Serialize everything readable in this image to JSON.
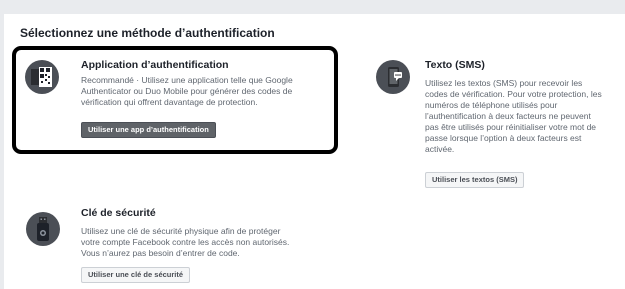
{
  "page": {
    "title": "Sélectionnez une méthode d’authentification"
  },
  "auth_app": {
    "icon": "qr-code-phone-icon",
    "title": "Application d’authentification",
    "desc_lines": [
      "Recommandé · Utilisez une application telle que Google",
      "Authenticator ou Duo Mobile pour générer des codes de",
      "vérification qui offrent davantage de protection."
    ],
    "button_label": "Utiliser une app d’authentification"
  },
  "sms": {
    "icon": "sms-phone-icon",
    "title": "Texto (SMS)",
    "desc_lines": [
      "Utilisez les textos (SMS) pour recevoir les",
      "codes de vérification. Pour votre protection, les",
      "numéros de téléphone utilisés pour",
      "l’authentification à deux facteurs ne peuvent",
      "pas être utilisés pour réinitialiser votre mot de",
      "passe lorsque l’option à deux facteurs est",
      "activée."
    ],
    "button_label": "Utiliser les textos (SMS)"
  },
  "security_key": {
    "icon": "usb-key-icon",
    "title": "Clé de sécurité",
    "desc_lines": [
      "Utilisez une clé de sécurité physique afin de protéger",
      "votre compte Facebook contre les accès non autorisés.",
      "Vous n’aurez pas besoin d’entrer de code."
    ],
    "button_label": "Utiliser une clé de sécurité"
  },
  "colors": {
    "background": "#e9ebee",
    "panel": "#ffffff",
    "highlight_border": "#000000",
    "primary_button": "#5f6368"
  }
}
